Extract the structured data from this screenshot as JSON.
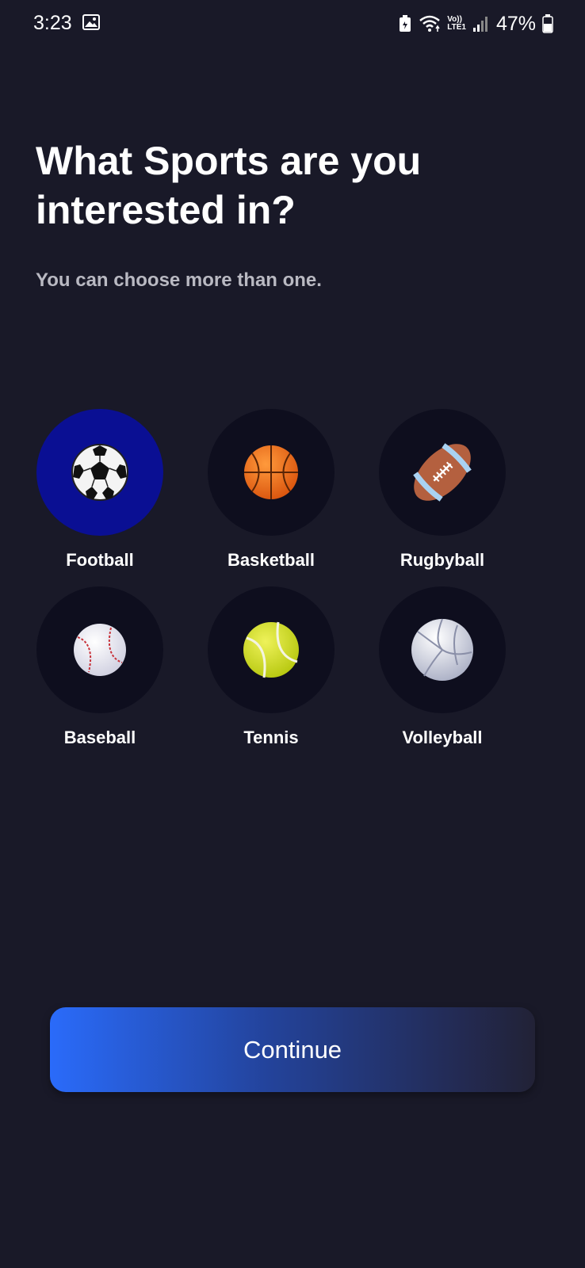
{
  "status_bar": {
    "time": "3:23",
    "network_text": "Vo))\nLTE1",
    "battery_percent": "47%",
    "icons": [
      "gallery-icon",
      "battery-saver-icon",
      "wifi-icon",
      "volte-lte-icon",
      "signal-icon",
      "battery-icon"
    ]
  },
  "header": {
    "title": "What Sports are you interested in?",
    "subtitle": "You can choose more than one."
  },
  "sports": [
    {
      "label": "Football",
      "icon": "soccer-ball-icon",
      "selected": true
    },
    {
      "label": "Basketball",
      "icon": "basketball-icon",
      "selected": false
    },
    {
      "label": "Rugbyball",
      "icon": "rugby-ball-icon",
      "selected": false
    },
    {
      "label": "Baseball",
      "icon": "baseball-icon",
      "selected": false
    },
    {
      "label": "Tennis",
      "icon": "tennis-ball-icon",
      "selected": false
    },
    {
      "label": "Volleyball",
      "icon": "volleyball-icon",
      "selected": false
    }
  ],
  "footer": {
    "continue_label": "Continue"
  },
  "colors": {
    "background": "#191928",
    "circle_unselected": "#0e0e1e",
    "circle_selected": "#0a0f93",
    "button_gradient_start": "#2a6bfa",
    "button_gradient_end": "#222236",
    "subtitle_text": "#b9b9c2"
  }
}
